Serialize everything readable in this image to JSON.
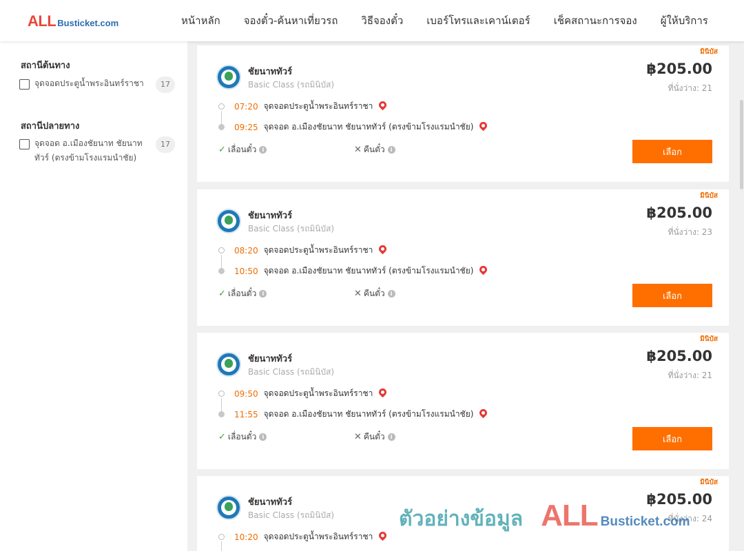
{
  "brand": {
    "logo_all": "ALL",
    "logo_domain": "Busticket.com"
  },
  "nav": [
    {
      "label": "หน้าหลัก"
    },
    {
      "label": "จองตั๋ว-ค้นหาเที่ยวรถ"
    },
    {
      "label": "วิธีจองตั๋ว"
    },
    {
      "label": "เบอร์โทรและเคาน์เตอร์"
    },
    {
      "label": "เช็คสถานะการจอง"
    },
    {
      "label": "ผู้ให้บริการ"
    }
  ],
  "sidebar": {
    "origin_title": "สถานีต้นทาง",
    "origin_options": [
      {
        "label": "จุดจอดประตูน้ำพระอินทร์ราชา",
        "count": "17"
      }
    ],
    "destination_title": "สถานีปลายทาง",
    "destination_options": [
      {
        "label": "จุดจอด อ.เมืองชัยนาท ชัยนาททัวร์ (ตรงข้ามโรงแรมนำชัย)",
        "count": "17"
      }
    ]
  },
  "trips": [
    {
      "tag": "มินิบัส",
      "operator": "ชัยนาททัวร์",
      "bus_class": "Basic Class (รถมินิบัส)",
      "price": "฿205.00",
      "seats": "ที่นั่งว่าง: 21",
      "depart_time": "07:20",
      "depart_stop": "จุดจอดประตูน้ำพระอินทร์ราชา",
      "arrive_time": "09:25",
      "arrive_stop": "จุดจอด อ.เมืองชัยนาท ชัยนาททัวร์ (ตรงข้ามโรงแรมนำชัย)",
      "postpone": "เลื่อนตั๋ว",
      "refund": "คืนตั๋ว",
      "select": "เลือก"
    },
    {
      "tag": "มินิบัส",
      "operator": "ชัยนาททัวร์",
      "bus_class": "Basic Class (รถมินิบัส)",
      "price": "฿205.00",
      "seats": "ที่นั่งว่าง: 23",
      "depart_time": "08:20",
      "depart_stop": "จุดจอดประตูน้ำพระอินทร์ราชา",
      "arrive_time": "10:50",
      "arrive_stop": "จุดจอด อ.เมืองชัยนาท ชัยนาททัวร์ (ตรงข้ามโรงแรมนำชัย)",
      "postpone": "เลื่อนตั๋ว",
      "refund": "คืนตั๋ว",
      "select": "เลือก"
    },
    {
      "tag": "มินิบัส",
      "operator": "ชัยนาททัวร์",
      "bus_class": "Basic Class (รถมินิบัส)",
      "price": "฿205.00",
      "seats": "ที่นั่งว่าง: 21",
      "depart_time": "09:50",
      "depart_stop": "จุดจอดประตูน้ำพระอินทร์ราชา",
      "arrive_time": "11:55",
      "arrive_stop": "จุดจอด อ.เมืองชัยนาท ชัยนาททัวร์ (ตรงข้ามโรงแรมนำชัย)",
      "postpone": "เลื่อนตั๋ว",
      "refund": "คืนตั๋ว",
      "select": "เลือก"
    },
    {
      "tag": "มินิบัส",
      "operator": "ชัยนาททัวร์",
      "bus_class": "Basic Class (รถมินิบัส)",
      "price": "฿205.00",
      "seats": "ที่นั่งว่าง: 24",
      "depart_time": "10:20",
      "depart_stop": "จุดจอดประตูน้ำพระอินทร์ราชา",
      "arrive_time": "",
      "arrive_stop": "",
      "postpone": "",
      "refund": "",
      "select": ""
    }
  ],
  "watermark": {
    "text": "ตัวอย่างข้อมูล",
    "logo_all": "ALL",
    "logo_domain": "Busticket.com"
  },
  "colors": {
    "accent": "#ff6f00",
    "time": "#ef6c00",
    "pin": "#e53935",
    "ok": "#43a047"
  }
}
